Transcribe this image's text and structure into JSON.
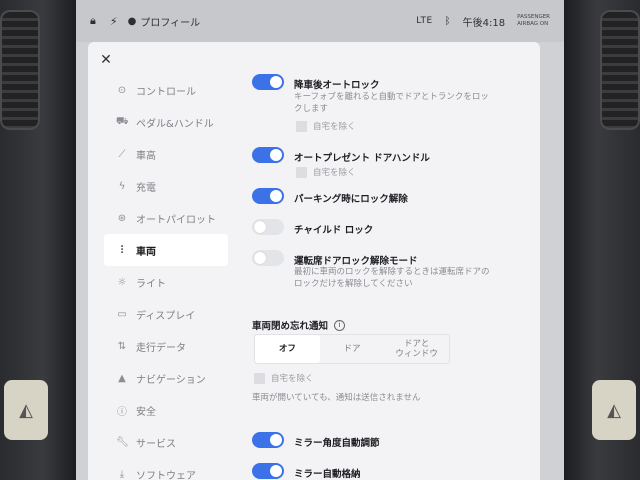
{
  "status_bar": {
    "profile_label": "プロフィール",
    "network": "LTE",
    "time": "午後4:18",
    "airbag_line1": "PASSENGER",
    "airbag_line2": "AIRBAG ON"
  },
  "sidebar": {
    "items": [
      {
        "label": "コントロール",
        "icon": "toggle-icon"
      },
      {
        "label": "ペダル&ハンドル",
        "icon": "car-icon"
      },
      {
        "label": "車高",
        "icon": "wrench-icon"
      },
      {
        "label": "充電",
        "icon": "bolt-icon"
      },
      {
        "label": "オートパイロット",
        "icon": "steering-wheel-icon"
      },
      {
        "label": "車両",
        "icon": "sliders-icon",
        "active": true
      },
      {
        "label": "ライト",
        "icon": "sun-icon"
      },
      {
        "label": "ディスプレイ",
        "icon": "display-icon"
      },
      {
        "label": "走行データ",
        "icon": "trip-icon"
      },
      {
        "label": "ナビゲーション",
        "icon": "navigation-icon"
      },
      {
        "label": "安全",
        "icon": "info-circle-icon"
      },
      {
        "label": "サービス",
        "icon": "wrench-icon"
      },
      {
        "label": "ソフトウェア",
        "icon": "download-icon"
      }
    ]
  },
  "options": {
    "walk_away_lock": {
      "title": "降車後オートロック",
      "desc": "キーフォブを離れると自動でドアとトランクをロックします",
      "checkbox": "自宅を除く",
      "on": true
    },
    "auto_present_handles": {
      "title": "オートプレゼント ドアハンドル",
      "checkbox": "自宅を除く",
      "on": true
    },
    "unlock_on_park": {
      "title": "パーキング時にロック解除",
      "on": true
    },
    "child_lock": {
      "title": "チャイルド ロック",
      "on": false
    },
    "driver_door_unlock": {
      "title": "運転席ドアロック解除モード",
      "desc": "最初に車両のロックを解除するときは運転席ドアのロックだけを解除してください",
      "on": false
    },
    "unlocked_notification": {
      "title": "車両閉め忘れ通知",
      "segments": [
        "オフ",
        "ドア",
        "ドアと\nウィンドウ"
      ],
      "selected": "オフ",
      "checkbox": "自宅を除く",
      "note": "車両が開いていても、通知は送信されません"
    },
    "mirror_tilt": {
      "title": "ミラー角度自動調節",
      "on": true
    },
    "mirror_fold": {
      "title": "ミラー自動格納",
      "on": true
    }
  },
  "colors": {
    "accent": "#3c72e8",
    "panel": "#f3f3f5"
  }
}
